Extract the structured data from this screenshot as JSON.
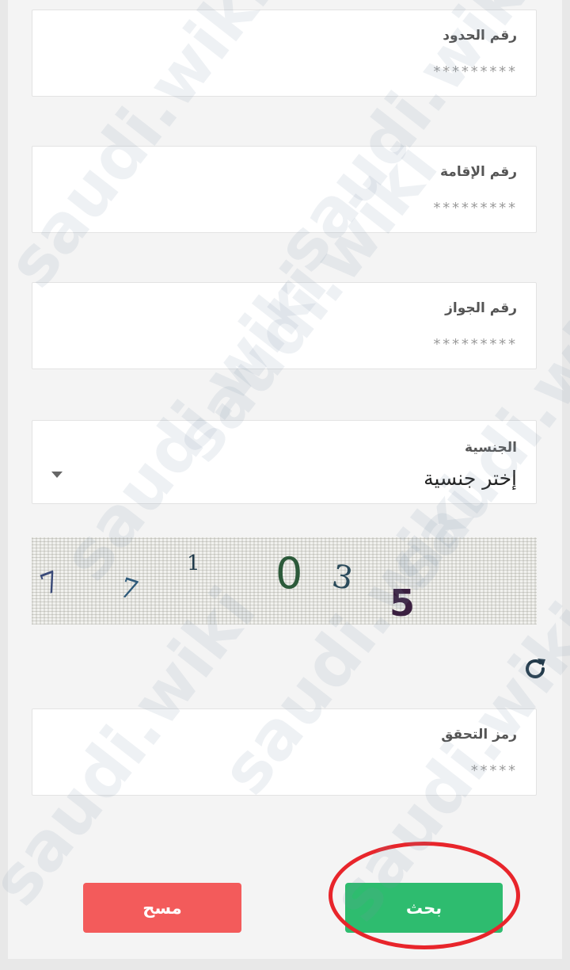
{
  "form": {
    "border_number": {
      "label": "رقم الحدود",
      "placeholder": "*********"
    },
    "iqama_number": {
      "label": "رقم الإقامة",
      "placeholder": "*********"
    },
    "passport_number": {
      "label": "رقم الجواز",
      "placeholder": "*********"
    },
    "nationality": {
      "label": "الجنسية",
      "selected": "إختر جنسية"
    },
    "captcha": {
      "characters": [
        "7",
        "7",
        "1",
        "0",
        "3",
        "5"
      ]
    },
    "verification_code": {
      "label": "رمز التحقق",
      "placeholder": "*****"
    }
  },
  "actions": {
    "clear_label": "مسح",
    "search_label": "بحث"
  },
  "watermark": "saudi.wiki",
  "colors": {
    "clear_button": "#f35b5b",
    "search_button": "#2ebc6f",
    "highlight": "#e8252b",
    "refresh_icon": "#233a4a"
  }
}
